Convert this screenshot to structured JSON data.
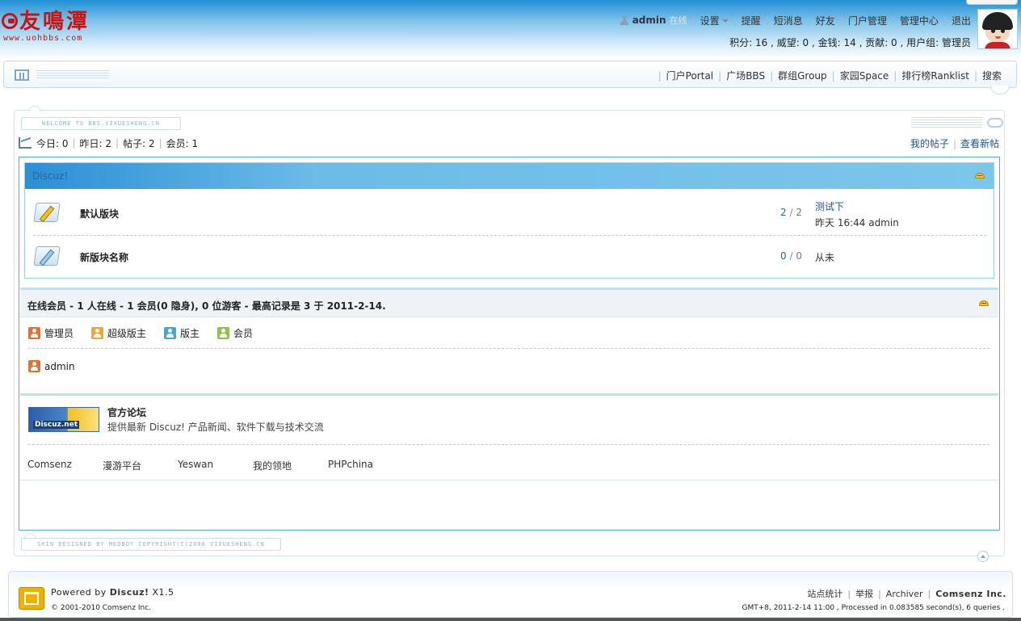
{
  "header": {
    "logo_text": "友鳴潭",
    "logo_url": "www.uohbbs.com",
    "user": {
      "name": "admin",
      "status": "在线"
    },
    "nav": [
      {
        "label": "设置",
        "has_dropdown": true
      },
      {
        "label": "提醒"
      },
      {
        "label": "短消息"
      },
      {
        "label": "好友"
      },
      {
        "label": "门户管理"
      },
      {
        "label": "管理中心"
      },
      {
        "label": "退出"
      }
    ],
    "stats": "积分: 16 , 威望: 0 , 金钱: 14 , 贡献: 0 , 用户组: 管理员"
  },
  "mainnav": {
    "items": [
      {
        "label": "门户Portal"
      },
      {
        "label": "广场BBS"
      },
      {
        "label": "群组Group"
      },
      {
        "label": "家园Space"
      },
      {
        "label": "排行榜Ranklist"
      },
      {
        "label": "搜索"
      }
    ]
  },
  "welcome_text": "WELCOME TO BBS.VIXUESHENG.CN",
  "board_stats": {
    "today": "今日: 0",
    "yesterday": "昨日: 2",
    "posts": "帖子: 2",
    "members": "会员: 1",
    "my_posts": "我的帖子",
    "new_posts": "查看新帖"
  },
  "category": {
    "title": "Discuz!",
    "forums": [
      {
        "name": "默认版块",
        "threads": "2",
        "posts": "2",
        "last_title": "测试下",
        "last_meta": "昨天 16:44 admin"
      },
      {
        "name": "新版块名称",
        "threads": "0",
        "posts": "0",
        "last_title": "",
        "last_meta": "从未"
      }
    ]
  },
  "online": {
    "title": "在线会员 - 1 人在线 - 1 会员(0 隐身), 0 位游客 - 最高记录是 3 于 2011-2-14.",
    "legend": [
      "管理员",
      "超级版主",
      "版主",
      "会员"
    ],
    "users": [
      "admin"
    ]
  },
  "links": {
    "banner_text": "Discuz.net",
    "official_title": "官方论坛",
    "official_desc": "提供最新 Discuz! 产品新闻、软件下载与技术交流",
    "partners": [
      "Comsenz",
      "漫游平台",
      "Yeswan",
      "我的领地",
      "PHPchina"
    ]
  },
  "skin_text": "SKIN DESIGNED BY MEDBOY COPYRIGHT(C)2008 VIXUESHENG.CN",
  "footer": {
    "powered_prefix": "Powered by",
    "product": "Discuz!",
    "version": "X1.5",
    "copyright": "© 2001-2010 Comsenz Inc.",
    "links": [
      "站点统计",
      "举报",
      "Archiver"
    ],
    "company": "Comsenz Inc.",
    "gmt": "GMT+8, 2011-2-14 11:00 , Processed in 0.083585 second(s), 6 queries ."
  },
  "colors": {
    "header_blue": "#1f8fd3",
    "category_bar": "#6cbbe8",
    "logo_red": "#cc1111",
    "link_blue": "#225588"
  }
}
